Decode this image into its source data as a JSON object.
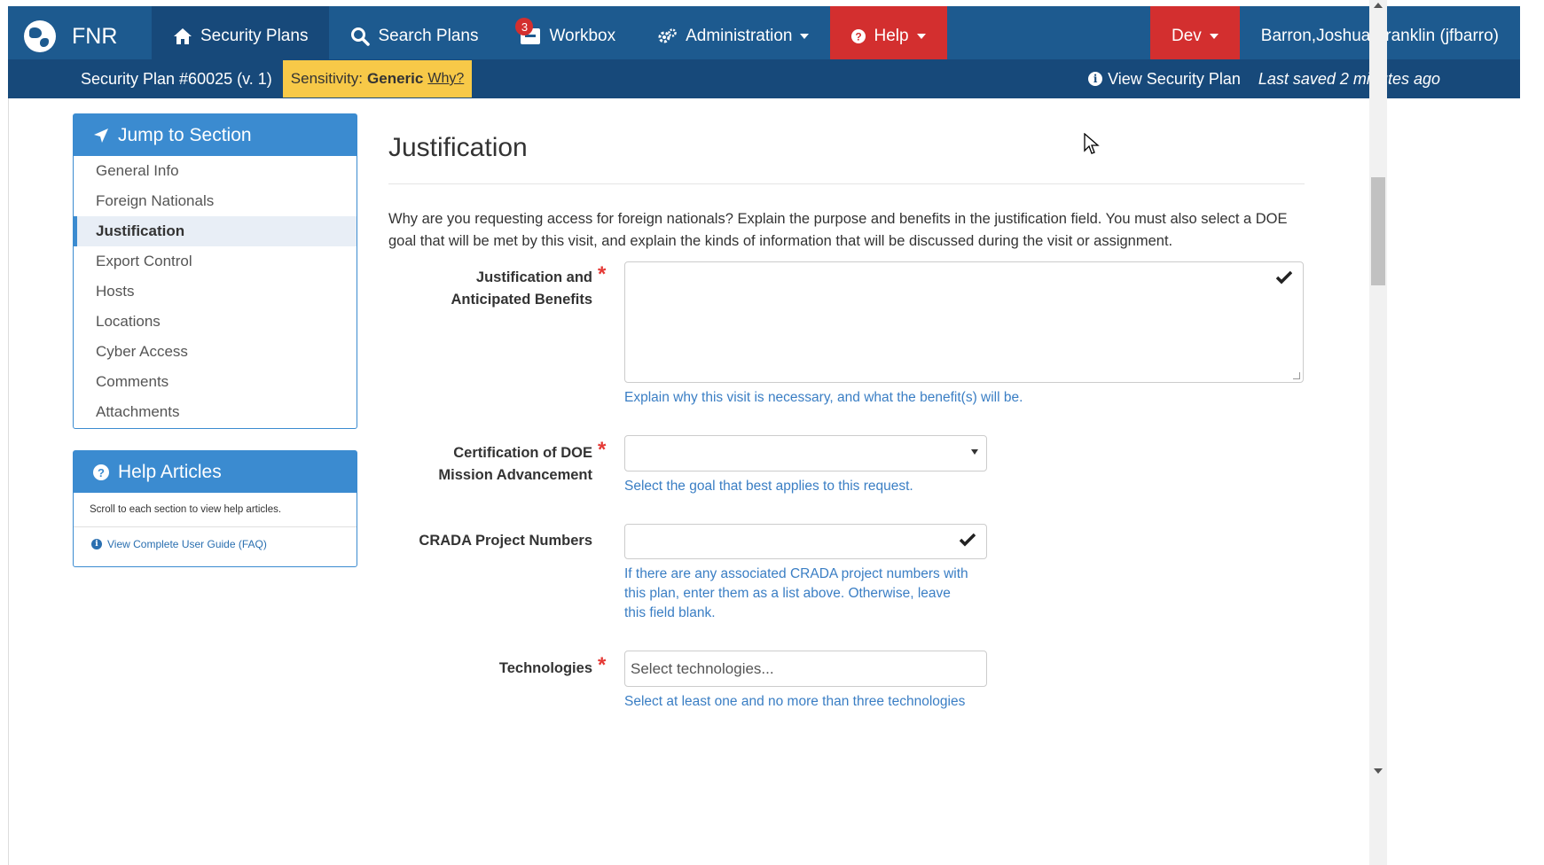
{
  "navbar": {
    "brand": "FNR",
    "items": [
      {
        "label": "Security Plans",
        "icon": "home-icon"
      },
      {
        "label": "Search Plans",
        "icon": "search-icon"
      },
      {
        "label": "Workbox",
        "icon": "inbox-icon",
        "badge": "3"
      },
      {
        "label": "Administration",
        "icon": "gears-icon"
      },
      {
        "label": "Help",
        "icon": "question-circle-icon"
      }
    ],
    "dev": "Dev",
    "user": "Barron,Joshua Franklin (jfbarro)"
  },
  "subbar": {
    "plan": "Security Plan #60025 (v. 1)",
    "sensitivity_label": "Sensitivity:",
    "sensitivity_value": "Generic",
    "why": "Why?",
    "view_plan": "View Security Plan",
    "last_saved": "Last saved 2 minutes ago"
  },
  "sidebar": {
    "jump_title": "Jump to Section",
    "sections": [
      "General Info",
      "Foreign Nationals",
      "Justification",
      "Export Control",
      "Hosts",
      "Locations",
      "Cyber Access",
      "Comments",
      "Attachments"
    ],
    "active_section": "Justification",
    "help_title": "Help Articles",
    "help_text": "Scroll to each section to view help articles.",
    "help_link": "View Complete User Guide (FAQ)"
  },
  "main": {
    "title": "Justification",
    "intro": "Why are you requesting access for foreign nationals? Explain the purpose and benefits in the justification field. You must also select a DOE goal that will be met by this visit, and explain the kinds of information that will be discussed during the visit or assignment.",
    "fields": {
      "justification": {
        "label_line1": "Justification and",
        "label_line2": "Anticipated Benefits",
        "value": "",
        "help": "Explain why this visit is necessary, and what the benefit(s) will be."
      },
      "certification": {
        "label_line1": "Certification of DOE",
        "label_line2": "Mission Advancement",
        "value": "",
        "help": "Select the goal that best applies to this request."
      },
      "crada": {
        "label": "CRADA Project Numbers",
        "value": "",
        "help_line1": "If there are any associated CRADA project numbers with",
        "help_line2": "this plan, enter them as a list above. Otherwise, leave",
        "help_line3": "this field blank."
      },
      "technologies": {
        "label": "Technologies",
        "placeholder": "Select technologies...",
        "help": "Select at least one and no more than three technologies"
      }
    }
  },
  "colors": {
    "navbar": "#1d5a8f",
    "subbar": "#17497a",
    "accent_red": "#d32f2f",
    "panel_blue": "#3b8bd0",
    "help_text_blue": "#3a7ec4",
    "sensitivity_yellow": "#f7c948"
  }
}
